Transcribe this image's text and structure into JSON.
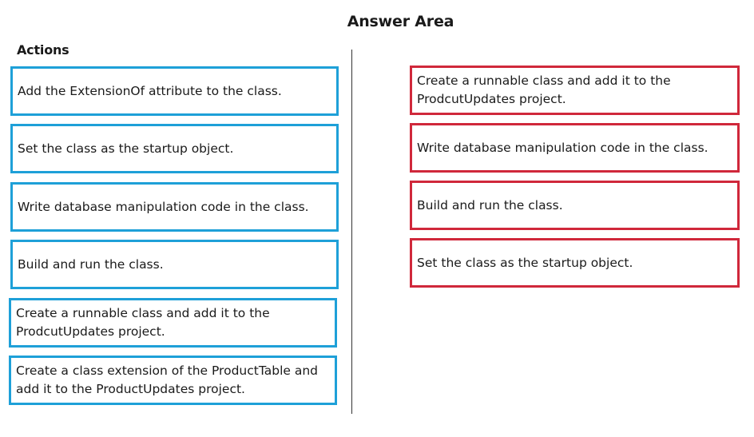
{
  "header": {
    "answer_area_title": "Answer Area",
    "actions_title": "Actions"
  },
  "colors": {
    "action_border": "#1ea0d8",
    "answer_border": "#d0283b"
  },
  "actions": [
    {
      "text": "Add the ExtensionOf attribute to the class."
    },
    {
      "text": "Set the class as the startup object."
    },
    {
      "text": "Write database manipulation code in the class."
    },
    {
      "text": "Build and run the class."
    },
    {
      "text": "Create a runnable class and add it to the ProdcutUpdates project."
    },
    {
      "text": "Create a class extension of the ProductTable and add it to the ProductUpdates project."
    }
  ],
  "answers": [
    {
      "text": "Create a runnable class and add it to the ProdcutUpdates project."
    },
    {
      "text": "Write database manipulation code in the class."
    },
    {
      "text": "Build and run the class."
    },
    {
      "text": "Set the class as the startup object."
    }
  ]
}
